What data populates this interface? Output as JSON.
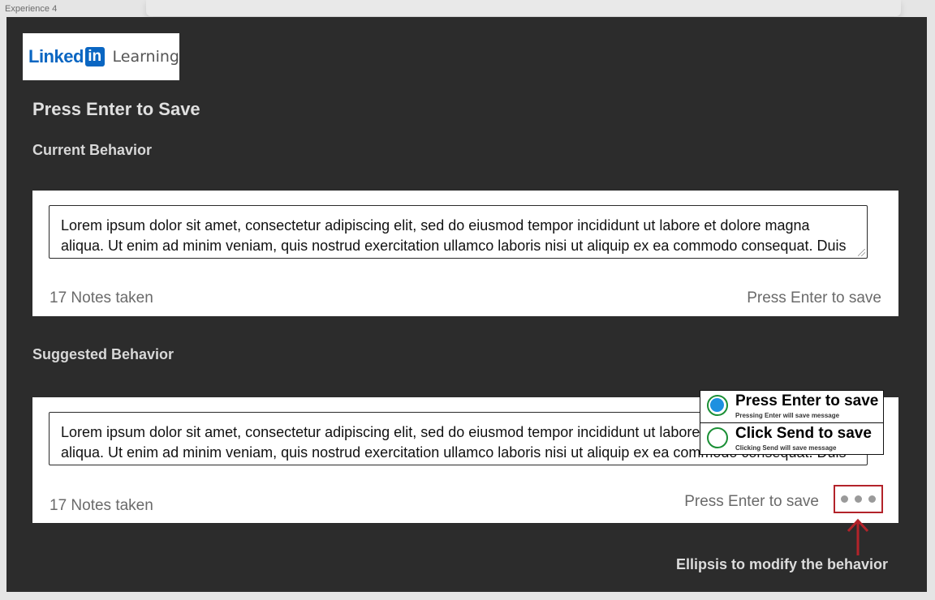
{
  "frame": {
    "label": "Experience 4"
  },
  "logo": {
    "linked": "Linked",
    "in": "in",
    "product": "Learning"
  },
  "page": {
    "title": "Press Enter to Save"
  },
  "current": {
    "heading": "Current Behavior",
    "note_text": "Lorem ipsum dolor sit amet, consectetur adipiscing elit, sed do eiusmod tempor incididunt ut labore et dolore magna aliqua. Ut enim ad minim veniam, quis nostrud exercitation ullamco laboris nisi ut aliquip ex ea commodo consequat. Duis aute irure dolor in reprehenderit in voluptate velit esse cillum dolore eu fugiat nulla pariatur.",
    "notes_count": "17 Notes taken",
    "enter_hint": "Press Enter to save"
  },
  "suggested": {
    "heading": "Suggested Behavior",
    "note_text": "Lorem ipsum dolor sit amet, consectetur adipiscing elit, sed do eiusmod tempor incididunt ut labore et dolore magna aliqua. Ut enim ad minim veniam, quis nostrud exercitation ullamco laboris nisi ut aliquip ex ea commodo consequat. Duis aute irure dolor in reprehenderit in voluptate velit esse cillum dolore eu fugiat nulla pariatur.",
    "notes_count": "17 Notes taken",
    "enter_hint": "Press Enter to save",
    "menu": {
      "options": [
        {
          "title": "Press Enter to save",
          "subtitle": "Pressing Enter will save message",
          "selected": true
        },
        {
          "title": "Click Send to save",
          "subtitle": "Clicking Send will save message",
          "selected": false
        }
      ]
    }
  },
  "annotation": {
    "text": "Ellipsis to modify the behavior"
  },
  "colors": {
    "canvas": "#2c2c2c",
    "linkedin_blue": "#0a66c2",
    "annotation_red": "#b3232a",
    "radio_green": "#1a8f35",
    "radio_fill": "#1e90e0"
  }
}
